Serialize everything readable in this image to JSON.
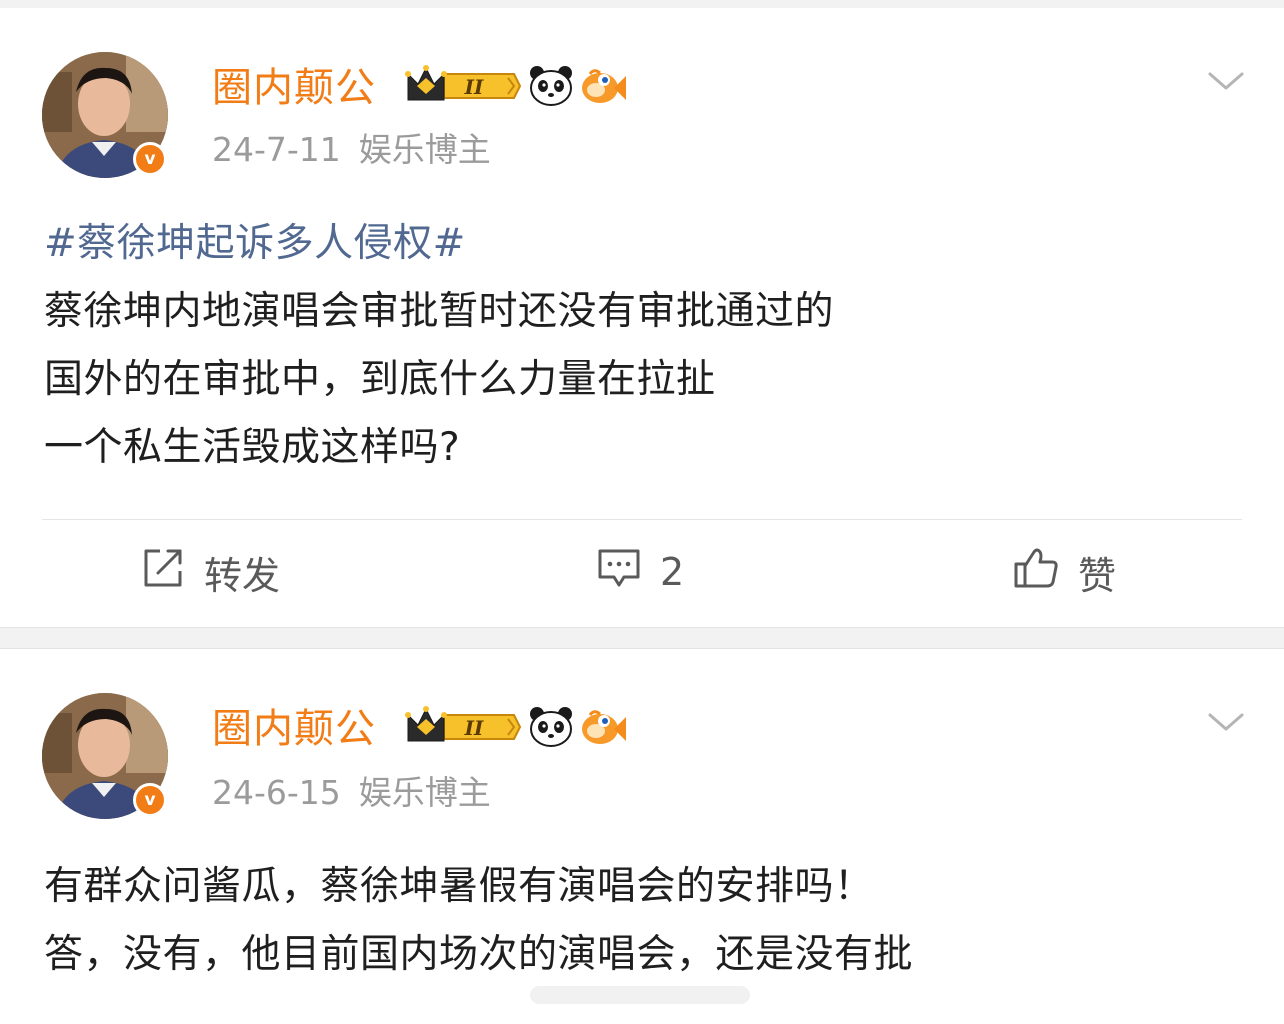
{
  "posts": [
    {
      "username": "圈内颠公",
      "level_badge": "II",
      "date": "24-7-11",
      "category": "娱乐博主",
      "verified_mark": "v",
      "hashtag": "#蔡徐坤起诉多人侵权#",
      "lines": [
        "蔡徐坤内地演唱会审批暂时还没有审批通过的",
        "国外的在审批中，到底什么力量在拉扯",
        "一个私生活毁成这样吗?"
      ],
      "actions": {
        "repost_label": "转发",
        "comment_count": "2",
        "like_label": "赞"
      }
    },
    {
      "username": "圈内颠公",
      "level_badge": "II",
      "date": "24-6-15",
      "category": "娱乐博主",
      "verified_mark": "v",
      "lines": [
        "有群众问酱瓜，蔡徐坤暑假有演唱会的安排吗！",
        "答，没有，他目前国内场次的演唱会，还是没有批"
      ]
    }
  ],
  "icons": {
    "crown": "crown-icon",
    "panda": "panda-icon",
    "fish": "fish-icon",
    "chevron": "chevron-down-icon",
    "repost": "repost-icon",
    "comment": "comment-icon",
    "like": "thumbs-up-icon"
  },
  "colors": {
    "username": "#f27c16",
    "hashtag": "#516891",
    "meta": "#9b9b9b",
    "body_text": "#1f1f1f",
    "verified_badge": "#f27c16"
  }
}
